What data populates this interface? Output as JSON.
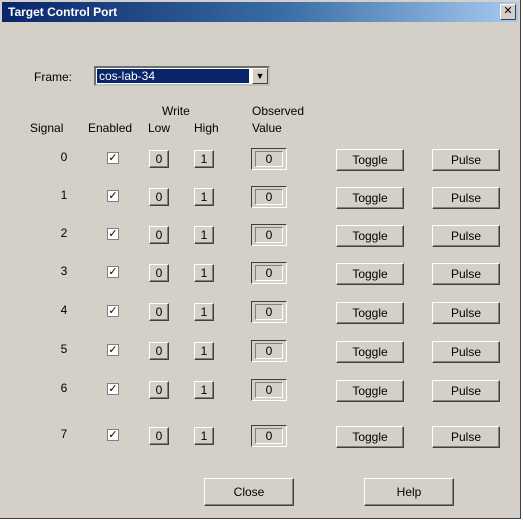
{
  "window": {
    "title": "Target Control Port",
    "close_glyph": "✕"
  },
  "frame": {
    "label": "Frame:",
    "value": "cos-lab-34",
    "arrow": "▼"
  },
  "headers": {
    "signal": "Signal",
    "enabled": "Enabled",
    "write": "Write",
    "low": "Low",
    "high": "High",
    "observed": "Observed",
    "value": "Value"
  },
  "rows": [
    {
      "signal": "0",
      "enabled": true,
      "low": "0",
      "high": "1",
      "observed": "0",
      "toggle": "Toggle",
      "pulse": "Pulse"
    },
    {
      "signal": "1",
      "enabled": true,
      "low": "0",
      "high": "1",
      "observed": "0",
      "toggle": "Toggle",
      "pulse": "Pulse"
    },
    {
      "signal": "2",
      "enabled": true,
      "low": "0",
      "high": "1",
      "observed": "0",
      "toggle": "Toggle",
      "pulse": "Pulse"
    },
    {
      "signal": "3",
      "enabled": true,
      "low": "0",
      "high": "1",
      "observed": "0",
      "toggle": "Toggle",
      "pulse": "Pulse"
    },
    {
      "signal": "4",
      "enabled": true,
      "low": "0",
      "high": "1",
      "observed": "0",
      "toggle": "Toggle",
      "pulse": "Pulse"
    },
    {
      "signal": "5",
      "enabled": true,
      "low": "0",
      "high": "1",
      "observed": "0",
      "toggle": "Toggle",
      "pulse": "Pulse"
    },
    {
      "signal": "6",
      "enabled": true,
      "low": "0",
      "high": "1",
      "observed": "0",
      "toggle": "Toggle",
      "pulse": "Pulse"
    },
    {
      "signal": "7",
      "enabled": true,
      "low": "0",
      "high": "1",
      "observed": "0",
      "toggle": "Toggle",
      "pulse": "Pulse"
    }
  ],
  "checkmark": "✓",
  "buttons": {
    "close": "Close",
    "help": "Help"
  }
}
